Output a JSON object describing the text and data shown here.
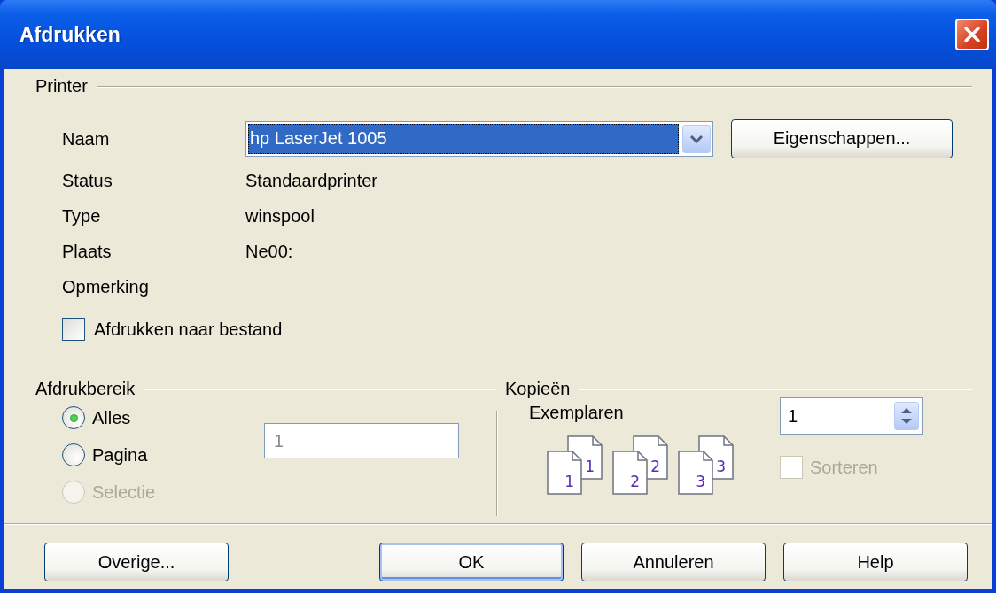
{
  "window": {
    "title": "Afdrukken"
  },
  "printer": {
    "legend": "Printer",
    "name": {
      "label": "Naam",
      "value": "hp LaserJet 1005"
    },
    "properties_button": {
      "label": "Eigenschappen..."
    },
    "info": [
      {
        "label": "Status",
        "value": "Standaardprinter"
      },
      {
        "label": "Type",
        "value": "winspool"
      },
      {
        "label": "Plaats",
        "value": "Ne00:"
      },
      {
        "label": "Opmerking"
      }
    ],
    "print_to_file": {
      "label": "Afdrukken naar bestand",
      "checked": false
    }
  },
  "range": {
    "legend": "Afdrukbereik",
    "options": [
      {
        "label": "Alles",
        "selected": true,
        "disabled": false
      },
      {
        "label": "Pagina",
        "selected": false,
        "disabled": false
      },
      {
        "label": "Selectie",
        "selected": false,
        "disabled": true
      }
    ],
    "pages_field": {
      "value": "1",
      "disabled": true
    }
  },
  "copies": {
    "legend": "Kopieën",
    "count": {
      "label": "Exemplaren",
      "value": "1"
    },
    "collate_icons": [
      {
        "front": "1",
        "back": "1"
      },
      {
        "front": "2",
        "back": "2"
      },
      {
        "front": "3",
        "back": "3"
      }
    ],
    "collate": {
      "label": "Sorteren",
      "checked": false,
      "disabled": true
    }
  },
  "buttons": [
    {
      "label": "Overige...",
      "default": false
    },
    {
      "label": "OK",
      "default": true
    },
    {
      "label": "Annuleren",
      "default": false
    },
    {
      "label": "Help",
      "default": false
    }
  ]
}
